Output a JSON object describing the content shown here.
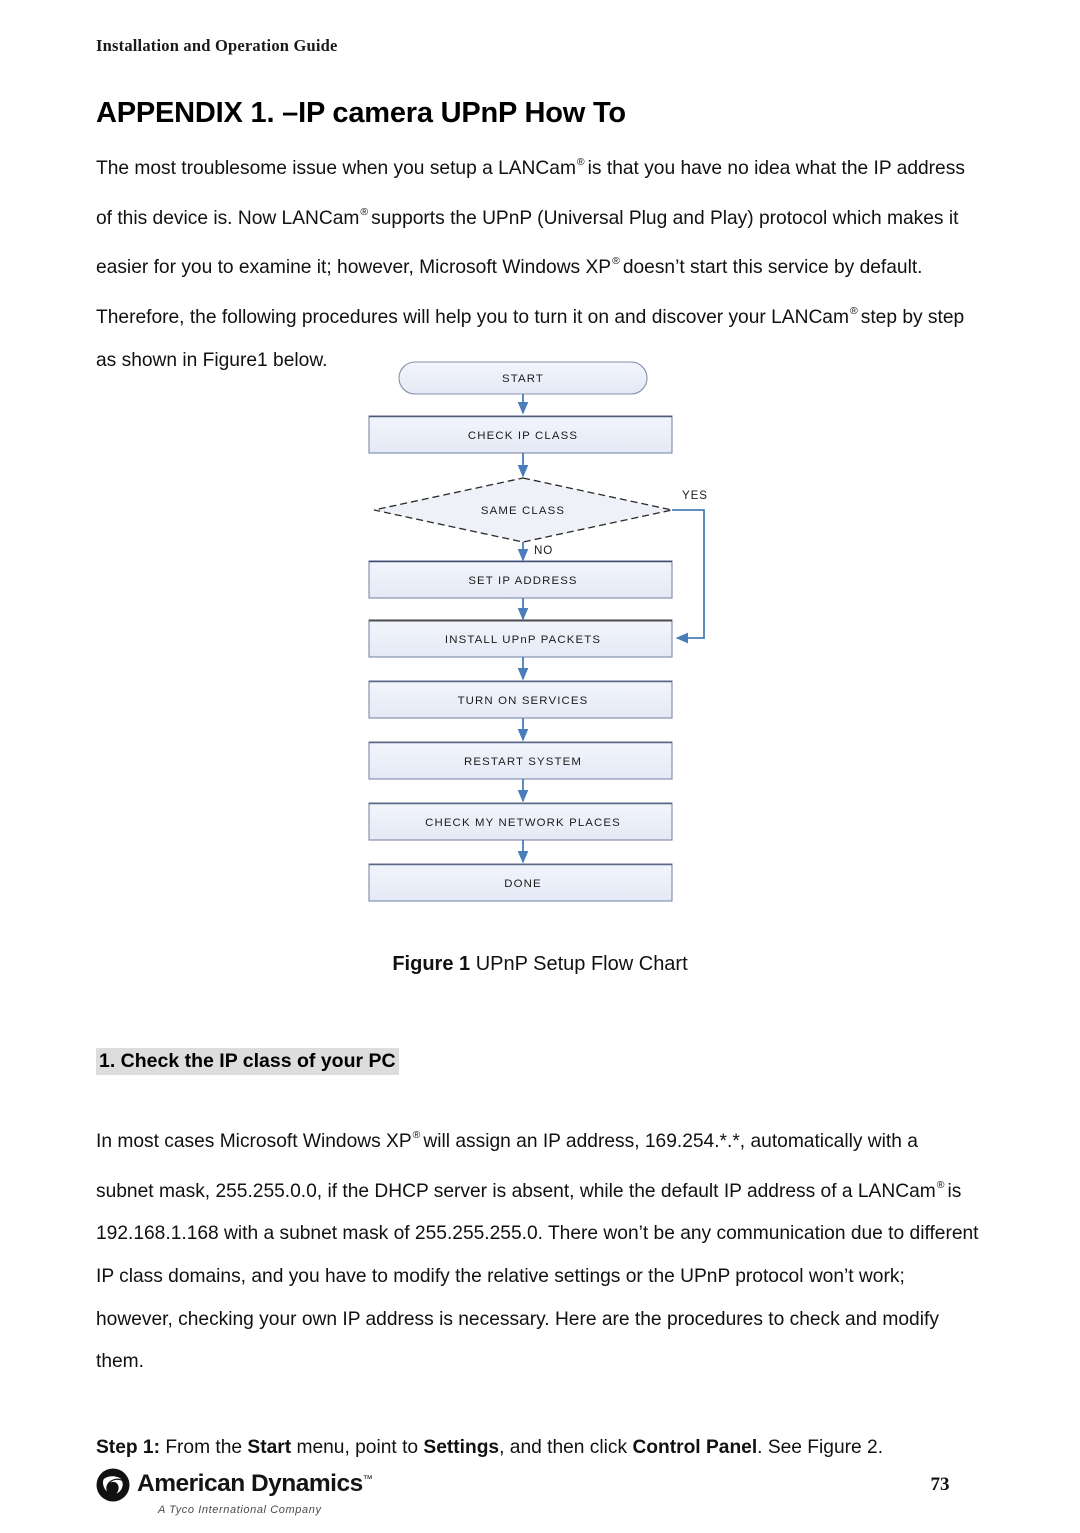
{
  "document": {
    "running_head": "Installation and Operation Guide",
    "page_number": "73"
  },
  "title": {
    "text": "APPENDIX 1. –IP camera UPnP How To"
  },
  "intro_paragraph": {
    "part1": "The most troublesome issue when you setup a LANCam",
    "reg1": "®",
    "part2": "is that you have no idea what the IP address of this device is. Now LANCam",
    "reg2": "®",
    "part3": "supports the UPnP (Universal Plug and Play) protocol which makes it easier for you to examine it; however, Microsoft Windows XP",
    "reg3": "®",
    "part4": "doesn’t start this service by default. Therefore, the following procedures will help you to turn it on and discover your LANCam",
    "reg4": "®",
    "part5": "step by step as shown in Figure1 below."
  },
  "flowchart": {
    "caption_strong": "Figure 1",
    "caption_rest": " UPnP Setup Flow Chart",
    "accent_color": "#4a7ebb",
    "box_fill": "#e8ecf7",
    "box_border": "#7b89a8",
    "nodes": [
      {
        "id": "start",
        "label": "START",
        "shape": "terminator"
      },
      {
        "id": "check-ip-class",
        "label": "CHECK IP CLASS",
        "shape": "process"
      },
      {
        "id": "same-class",
        "label": "SAME CLASS",
        "shape": "decision"
      },
      {
        "id": "set-ip-address",
        "label": "SET IP ADDRESS",
        "shape": "process"
      },
      {
        "id": "install-upnp-packets",
        "label": "INSTALL UPnP PACKETS",
        "shape": "process"
      },
      {
        "id": "turn-on-services",
        "label": "TURN ON SERVICES",
        "shape": "process"
      },
      {
        "id": "restart-system",
        "label": "RESTART SYSTEM",
        "shape": "process"
      },
      {
        "id": "check-my-network-places",
        "label": "CHECK MY NETWORK PLACES",
        "shape": "process"
      },
      {
        "id": "done",
        "label": "DONE",
        "shape": "process"
      }
    ],
    "branch_labels": {
      "yes": "YES",
      "no": "NO"
    }
  },
  "section": {
    "heading": "1. Check the IP class of your PC",
    "paragraph": {
      "part1": "In most cases Microsoft Windows XP",
      "reg1": "®",
      "part2": "will assign an IP address, 169.254.*.*, automatically with a subnet mask, 255.255.0.0, if the DHCP server is absent, while the default IP address of a LANCam",
      "reg2": "®",
      "part3": "is 192.168.1.168 with a subnet mask of 255.255.255.0. There won’t be any communication due to different IP class domains, and you have to modify the relative settings or the UPnP protocol won’t work; however, checking your own IP address is necessary. Here are the procedures to check and modify them."
    }
  },
  "step": {
    "label": "Step 1:",
    "text1": " From the ",
    "bold1": "Start",
    "text2": " menu, point to ",
    "bold2": "Settings",
    "text3": ", and then click ",
    "bold3": "Control Panel",
    "text4": ". See Figure 2."
  },
  "footer": {
    "brand": "American Dynamics",
    "brand_tm": "™",
    "tagline": "A Tyco International Company"
  }
}
